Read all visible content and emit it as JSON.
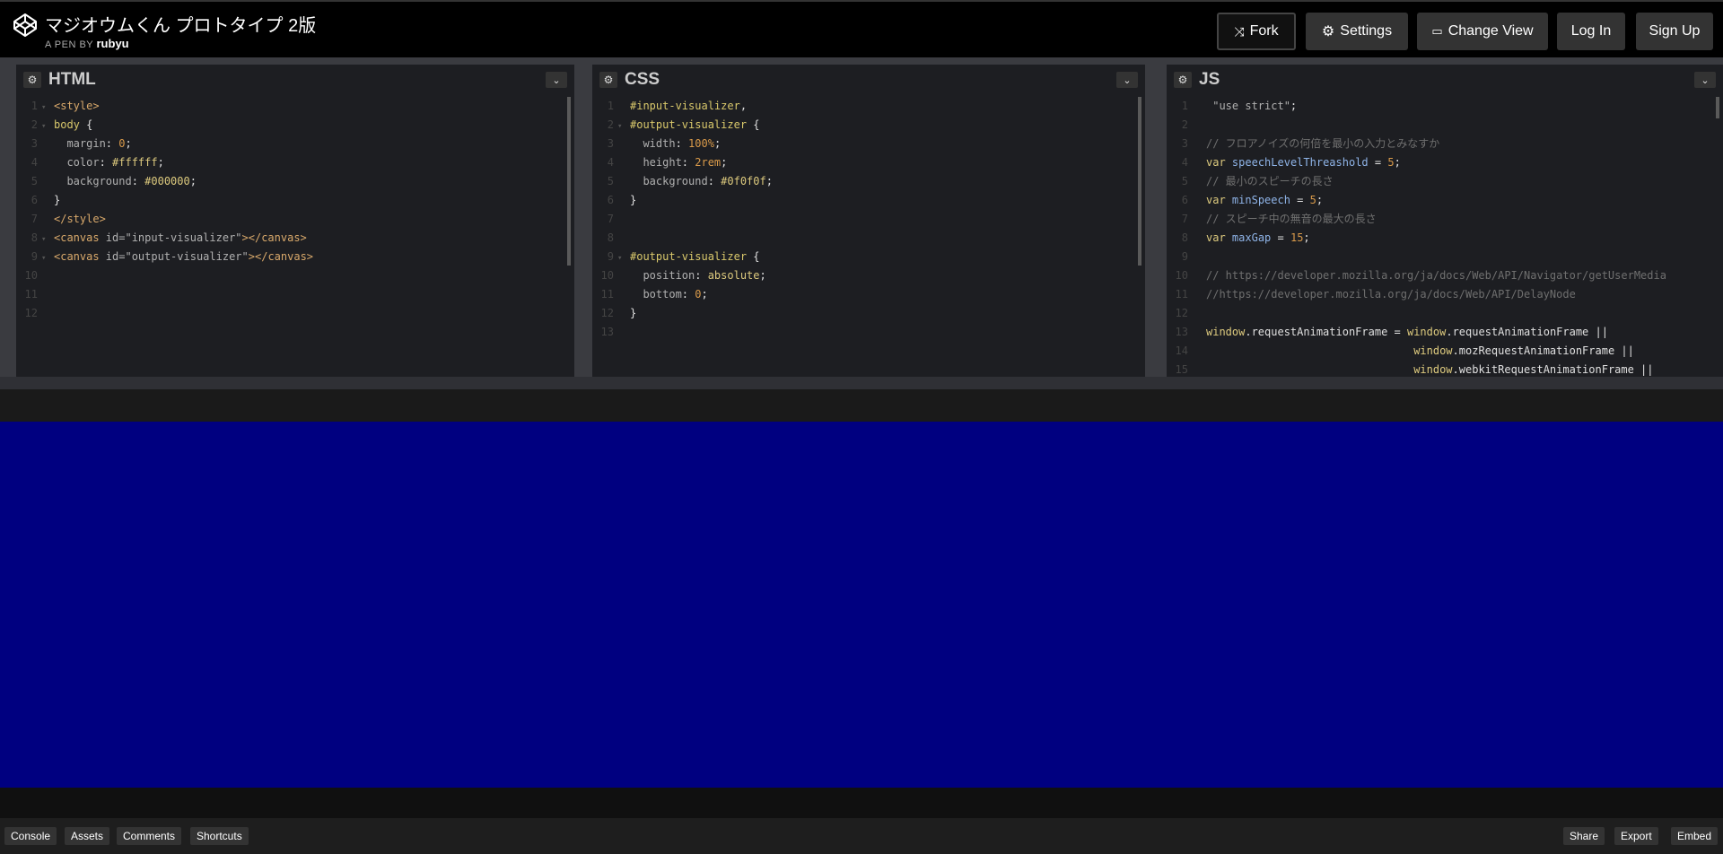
{
  "header": {
    "title": "マジオウムくん プロトタイプ 2版",
    "byline_prefix": "A PEN BY",
    "author": "rubyu",
    "buttons": {
      "fork": "Fork",
      "settings": "Settings",
      "change_view": "Change View",
      "log_in": "Log In",
      "sign_up": "Sign Up"
    }
  },
  "panels": {
    "html": {
      "title": "HTML"
    },
    "css": {
      "title": "CSS"
    },
    "js": {
      "title": "JS"
    }
  },
  "html_lines": [
    [
      [
        "t-tag",
        "<style>"
      ]
    ],
    [
      [
        "t-sel",
        "body"
      ],
      [
        "t-def",
        " {"
      ]
    ],
    [
      [
        "t-prop",
        "  margin"
      ],
      [
        "t-def",
        ": "
      ],
      [
        "t-num",
        "0"
      ],
      [
        "t-def",
        ";"
      ]
    ],
    [
      [
        "t-prop",
        "  color"
      ],
      [
        "t-def",
        ": "
      ],
      [
        "t-col",
        "#ffffff"
      ],
      [
        "t-def",
        ";"
      ]
    ],
    [
      [
        "t-prop",
        "  background"
      ],
      [
        "t-def",
        ": "
      ],
      [
        "t-col",
        "#000000"
      ],
      [
        "t-def",
        ";"
      ]
    ],
    [
      [
        "t-def",
        "}"
      ]
    ],
    [
      [
        "t-tag",
        "</style>"
      ]
    ],
    [
      [
        "t-tag",
        "<canvas"
      ],
      [
        "t-attr",
        " id="
      ],
      [
        "t-str",
        "\"input-visualizer\""
      ],
      [
        "t-tag",
        "></canvas>"
      ]
    ],
    [
      [
        "t-tag",
        "<canvas"
      ],
      [
        "t-attr",
        " id="
      ],
      [
        "t-str",
        "\"output-visualizer\""
      ],
      [
        "t-tag",
        "></canvas>"
      ]
    ],
    [],
    [],
    []
  ],
  "html_folds": [
    1,
    2,
    0,
    0,
    0,
    0,
    0,
    1,
    1,
    0,
    0,
    0
  ],
  "css_lines": [
    [
      [
        "t-sel",
        "#input-visualizer"
      ],
      [
        "t-def",
        ","
      ]
    ],
    [
      [
        "t-sel",
        "#output-visualizer"
      ],
      [
        "t-def",
        " {"
      ]
    ],
    [
      [
        "t-prop",
        "  width"
      ],
      [
        "t-def",
        ": "
      ],
      [
        "t-num",
        "100%"
      ],
      [
        "t-def",
        ";"
      ]
    ],
    [
      [
        "t-prop",
        "  height"
      ],
      [
        "t-def",
        ": "
      ],
      [
        "t-num",
        "2rem"
      ],
      [
        "t-def",
        ";"
      ]
    ],
    [
      [
        "t-prop",
        "  background"
      ],
      [
        "t-def",
        ": "
      ],
      [
        "t-col",
        "#0f0f0f"
      ],
      [
        "t-def",
        ";"
      ]
    ],
    [
      [
        "t-def",
        "}"
      ]
    ],
    [],
    [],
    [
      [
        "t-sel",
        "#output-visualizer"
      ],
      [
        "t-def",
        " {"
      ]
    ],
    [
      [
        "t-prop",
        "  position"
      ],
      [
        "t-def",
        ": "
      ],
      [
        "t-val",
        "absolute"
      ],
      [
        "t-def",
        ";"
      ]
    ],
    [
      [
        "t-prop",
        "  bottom"
      ],
      [
        "t-def",
        ": "
      ],
      [
        "t-num",
        "0"
      ],
      [
        "t-def",
        ";"
      ]
    ],
    [
      [
        "t-def",
        "}"
      ]
    ],
    []
  ],
  "css_folds": [
    0,
    2,
    0,
    0,
    0,
    0,
    0,
    0,
    1,
    0,
    0,
    0,
    0
  ],
  "js_lines": [
    [
      [
        "t-str",
        " \"use strict\""
      ],
      [
        "t-def",
        ";"
      ]
    ],
    [],
    [
      [
        "t-com",
        "// フロアノイズの何倍を最小の入力とみなすか"
      ]
    ],
    [
      [
        "t-kw",
        "var"
      ],
      [
        "t-def",
        " "
      ],
      [
        "t-var",
        "speechLevelThreashold"
      ],
      [
        "t-def",
        " = "
      ],
      [
        "t-num",
        "5"
      ],
      [
        "t-def",
        ";"
      ]
    ],
    [
      [
        "t-com",
        "// 最小のスピーチの長さ"
      ]
    ],
    [
      [
        "t-kw",
        "var"
      ],
      [
        "t-def",
        " "
      ],
      [
        "t-var",
        "minSpeech"
      ],
      [
        "t-def",
        " = "
      ],
      [
        "t-num",
        "5"
      ],
      [
        "t-def",
        ";"
      ]
    ],
    [
      [
        "t-com",
        "// スピーチ中の無音の最大の長さ"
      ]
    ],
    [
      [
        "t-kw",
        "var"
      ],
      [
        "t-def",
        " "
      ],
      [
        "t-var",
        "maxGap"
      ],
      [
        "t-def",
        " = "
      ],
      [
        "t-num",
        "15"
      ],
      [
        "t-def",
        ";"
      ]
    ],
    [],
    [
      [
        "t-com",
        "// https://developer.mozilla.org/ja/docs/Web/API/Navigator/getUserMedia"
      ]
    ],
    [
      [
        "t-com",
        "//https://developer.mozilla.org/ja/docs/Web/API/DelayNode"
      ]
    ],
    [],
    [
      [
        "t-kw",
        "window"
      ],
      [
        "t-def",
        ".requestAnimationFrame = "
      ],
      [
        "t-kw",
        "window"
      ],
      [
        "t-def",
        ".requestAnimationFrame ||"
      ]
    ],
    [
      [
        "t-def",
        "                                "
      ],
      [
        "t-kw",
        "window"
      ],
      [
        "t-def",
        ".mozRequestAnimationFrame ||"
      ]
    ],
    [
      [
        "t-def",
        "                                "
      ],
      [
        "t-kw",
        "window"
      ],
      [
        "t-def",
        ".webkitRequestAnimationFrame ||"
      ]
    ]
  ],
  "footer": {
    "console": "Console",
    "assets": "Assets",
    "comments": "Comments",
    "shortcuts": "Shortcuts",
    "share": "Share",
    "export": "Export",
    "embed": "Embed"
  }
}
